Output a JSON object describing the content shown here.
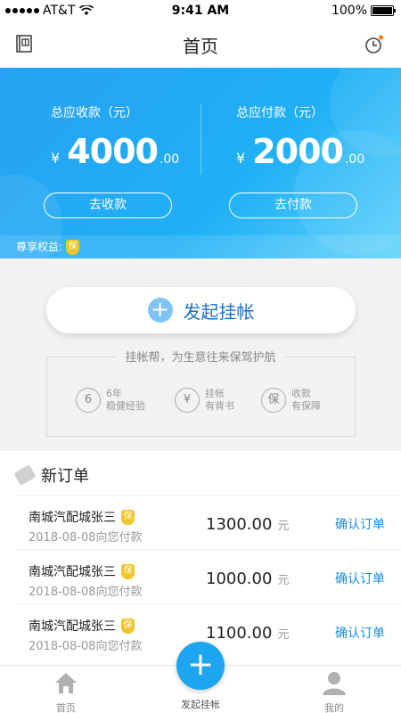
{
  "status": {
    "carrier": "AT&T",
    "time": "9:41 AM",
    "battery": "100%"
  },
  "nav": {
    "title": "首页",
    "left_icon": "ledger-icon",
    "right_icon": "clock-icon"
  },
  "summary": {
    "receivable": {
      "label": "总应收款（元）",
      "currency": "¥",
      "integer": "4000",
      "decimal": ".00",
      "button": "去收款"
    },
    "payable": {
      "label": "总应付款（元）",
      "currency": "¥",
      "integer": "2000",
      "decimal": ".00",
      "button": "去付款"
    },
    "benefit_label": "尊享权益:",
    "benefit_badge": "保"
  },
  "launch": {
    "label": "发起挂帐",
    "icon": "plus-icon"
  },
  "slogan": "挂帐帮，为生意往来保驾护航",
  "features": [
    {
      "icon_text": "6",
      "line1": "6年",
      "line2": "稳健经验"
    },
    {
      "icon_text": "¥",
      "line1": "挂帐",
      "line2": "有背书"
    },
    {
      "icon_text": "保",
      "line1": "收款",
      "line2": "有保障"
    }
  ],
  "orders": {
    "title": "新订单",
    "unit": "元",
    "confirm_label": "确认订单",
    "badge": "保",
    "items": [
      {
        "name": "南城汽配城张三",
        "desc": "2018-08-08向您付款",
        "amount": "1300.00"
      },
      {
        "name": "南城汽配城张三",
        "desc": "2018-08-08向您付款",
        "amount": "1000.00"
      },
      {
        "name": "南城汽配城张三",
        "desc": "2018-08-08向您付款",
        "amount": "1100.00"
      }
    ]
  },
  "tabs": {
    "home": "首页",
    "launch": "发起挂帐",
    "mine": "我的"
  },
  "colors": {
    "primary": "#1da5ef",
    "accent": "#f0c52a",
    "link": "#1a8ee0"
  }
}
